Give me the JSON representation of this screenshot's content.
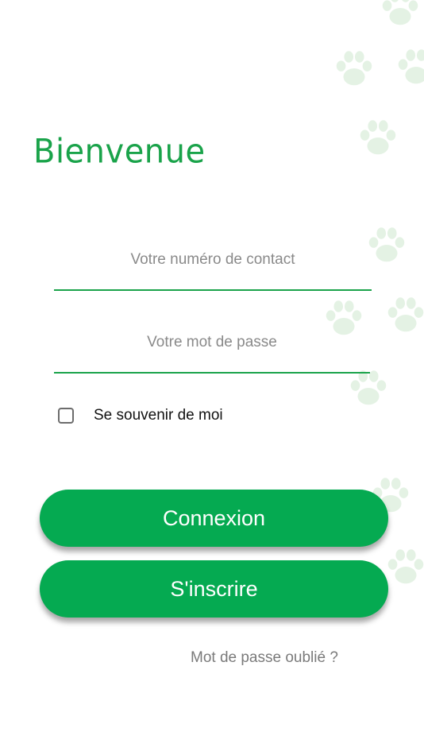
{
  "header": {
    "title": "Bienvenue"
  },
  "form": {
    "contact_placeholder": "Votre numéro de contact",
    "contact_value": "",
    "password_placeholder": "Votre mot de passe",
    "password_value": "",
    "remember_label": "Se souvenir de moi",
    "remember_checked": false
  },
  "actions": {
    "login_label": "Connexion",
    "signup_label": "S'inscrire",
    "forgot_label": "Mot de passe oublié ?"
  },
  "theme": {
    "accent": "#05aa51",
    "title_color": "#1aa34a",
    "paw_color": "#cfe8cf"
  },
  "decor": {
    "background_icon": "paw-print-icon"
  }
}
